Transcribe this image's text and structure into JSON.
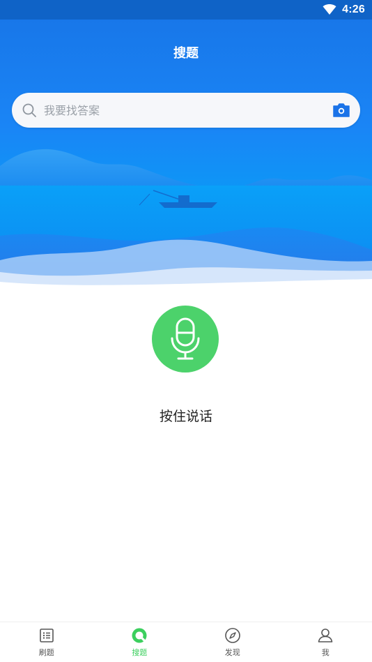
{
  "status_bar": {
    "time": "4:26",
    "wifi_icon": "wifi-icon"
  },
  "header": {
    "title": "搜题"
  },
  "search": {
    "placeholder": "我要找答案",
    "search_icon": "search-icon",
    "camera_icon": "camera-icon"
  },
  "voice": {
    "mic_icon": "microphone-icon",
    "label": "按住说话",
    "color": "#4cd26b"
  },
  "bottom_nav": {
    "items": [
      {
        "label": "刷题",
        "icon": "list-icon",
        "active": false
      },
      {
        "label": "搜题",
        "icon": "search-circle-icon",
        "active": true
      },
      {
        "label": "发现",
        "icon": "compass-icon",
        "active": false
      },
      {
        "label": "我",
        "icon": "user-icon",
        "active": false
      }
    ],
    "active_color": "#3ccf5e"
  },
  "colors": {
    "primary_blue": "#1a85f6",
    "status_bar": "#0f63c7"
  }
}
